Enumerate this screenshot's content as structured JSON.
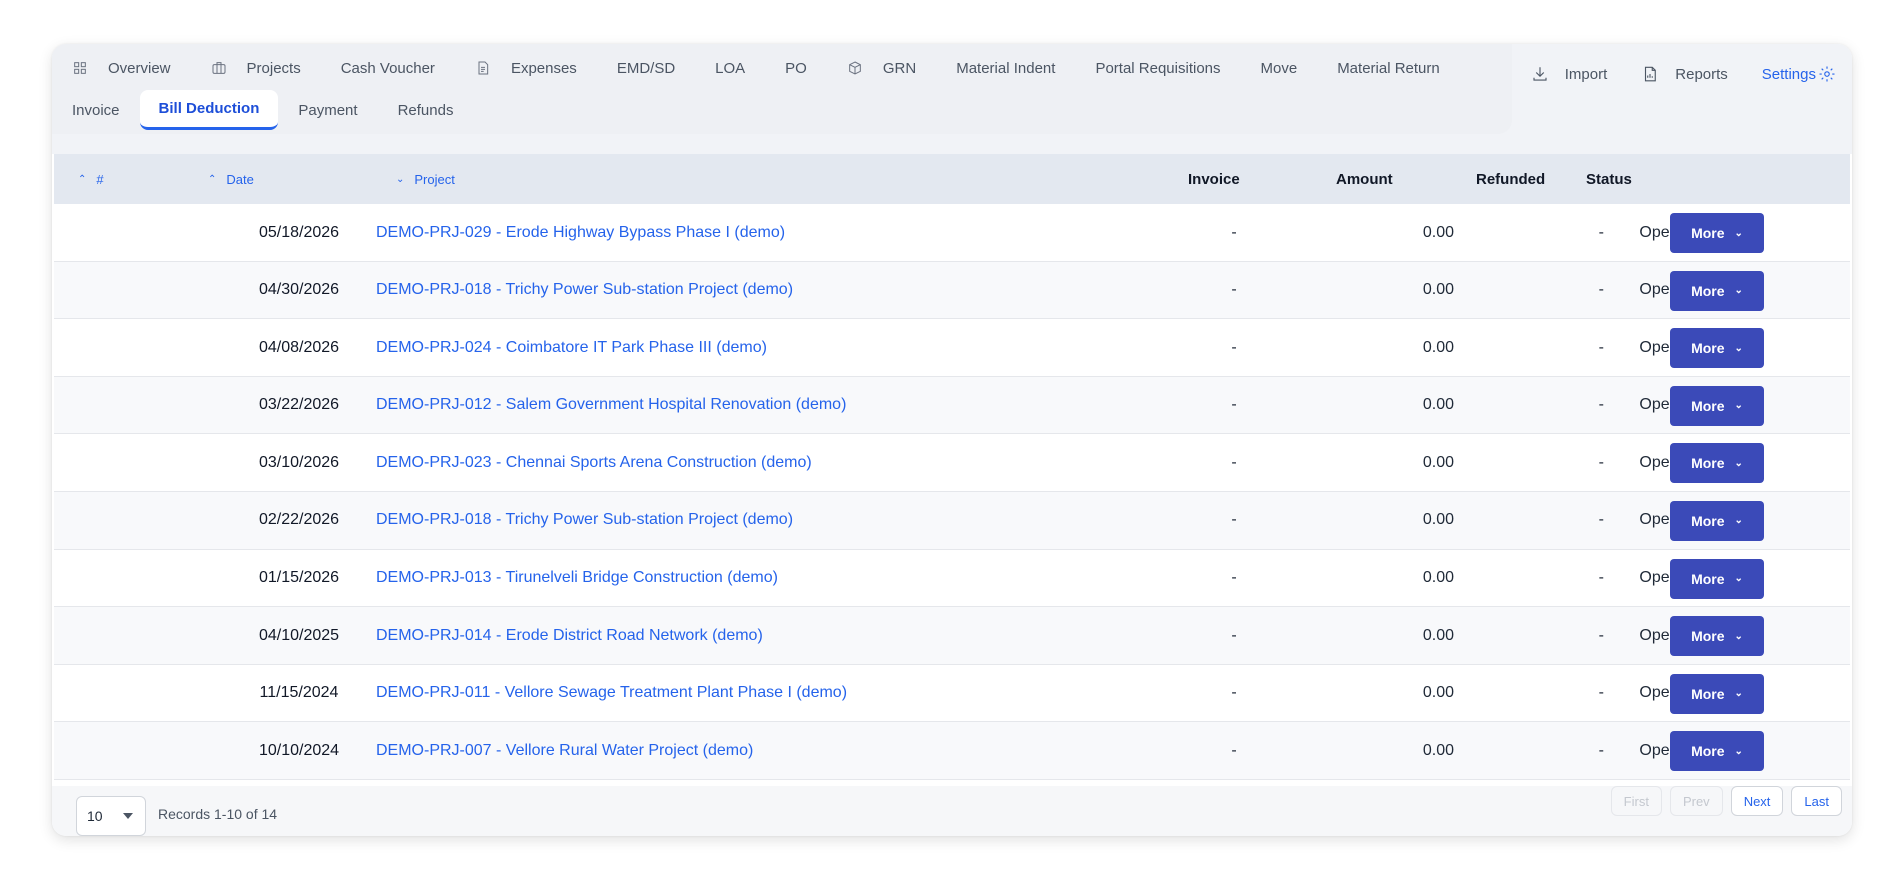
{
  "nav": {
    "row1": [
      {
        "label": "Overview",
        "icon": "grid-icon"
      },
      {
        "label": "Projects",
        "icon": "briefcase-icon"
      },
      {
        "label": "Cash Voucher",
        "icon": ""
      },
      {
        "label": "Expenses",
        "icon": "document-icon"
      },
      {
        "label": "EMD/SD",
        "icon": ""
      },
      {
        "label": "LOA",
        "icon": ""
      },
      {
        "label": "PO",
        "icon": ""
      },
      {
        "label": "GRN",
        "icon": "box-icon"
      },
      {
        "label": "Material Indent",
        "icon": ""
      },
      {
        "label": "Portal Requisitions",
        "icon": ""
      },
      {
        "label": "Move",
        "icon": ""
      },
      {
        "label": "Material Return",
        "icon": ""
      }
    ],
    "row2": [
      {
        "label": "Invoice",
        "active": false
      },
      {
        "label": "Bill Deduction",
        "active": true
      },
      {
        "label": "Payment",
        "active": false
      },
      {
        "label": "Refunds",
        "active": false
      }
    ]
  },
  "actions": {
    "import": "Import",
    "reports": "Reports",
    "settings": "Settings"
  },
  "table": {
    "headers": {
      "num": "#",
      "date": "Date",
      "project": "Project",
      "invoice": "Invoice",
      "amount": "Amount",
      "refunded": "Refunded",
      "status": "Status"
    },
    "more_label": "More",
    "rows": [
      {
        "date": "05/18/2026",
        "project": "DEMO-PRJ-029 - Erode Highway Bypass Phase I (demo)",
        "invoice": "-",
        "amount": "0.00",
        "refunded": "-",
        "status": "Open"
      },
      {
        "date": "04/30/2026",
        "project": "DEMO-PRJ-018 - Trichy Power Sub-station Project (demo)",
        "invoice": "-",
        "amount": "0.00",
        "refunded": "-",
        "status": "Open"
      },
      {
        "date": "04/08/2026",
        "project": "DEMO-PRJ-024 - Coimbatore IT Park Phase III (demo)",
        "invoice": "-",
        "amount": "0.00",
        "refunded": "-",
        "status": "Open"
      },
      {
        "date": "03/22/2026",
        "project": "DEMO-PRJ-012 - Salem Government Hospital Renovation (demo)",
        "invoice": "-",
        "amount": "0.00",
        "refunded": "-",
        "status": "Open"
      },
      {
        "date": "03/10/2026",
        "project": "DEMO-PRJ-023 - Chennai Sports Arena Construction (demo)",
        "invoice": "-",
        "amount": "0.00",
        "refunded": "-",
        "status": "Open"
      },
      {
        "date": "02/22/2026",
        "project": "DEMO-PRJ-018 - Trichy Power Sub-station Project (demo)",
        "invoice": "-",
        "amount": "0.00",
        "refunded": "-",
        "status": "Open"
      },
      {
        "date": "01/15/2026",
        "project": "DEMO-PRJ-013 - Tirunelveli Bridge Construction (demo)",
        "invoice": "-",
        "amount": "0.00",
        "refunded": "-",
        "status": "Open"
      },
      {
        "date": "04/10/2025",
        "project": "DEMO-PRJ-014 - Erode District Road Network (demo)",
        "invoice": "-",
        "amount": "0.00",
        "refunded": "-",
        "status": "Open"
      },
      {
        "date": "11/15/2024",
        "project": "DEMO-PRJ-011 - Vellore Sewage Treatment Plant Phase I (demo)",
        "invoice": "-",
        "amount": "0.00",
        "refunded": "-",
        "status": "Open"
      },
      {
        "date": "10/10/2024",
        "project": "DEMO-PRJ-007 - Vellore Rural Water Project (demo)",
        "invoice": "-",
        "amount": "0.00",
        "refunded": "-",
        "status": "Open"
      }
    ]
  },
  "footer": {
    "page_size": "10",
    "records": "Records 1-10 of 14",
    "pager": {
      "first": "First",
      "prev": "Prev",
      "next": "Next",
      "last": "Last"
    }
  }
}
